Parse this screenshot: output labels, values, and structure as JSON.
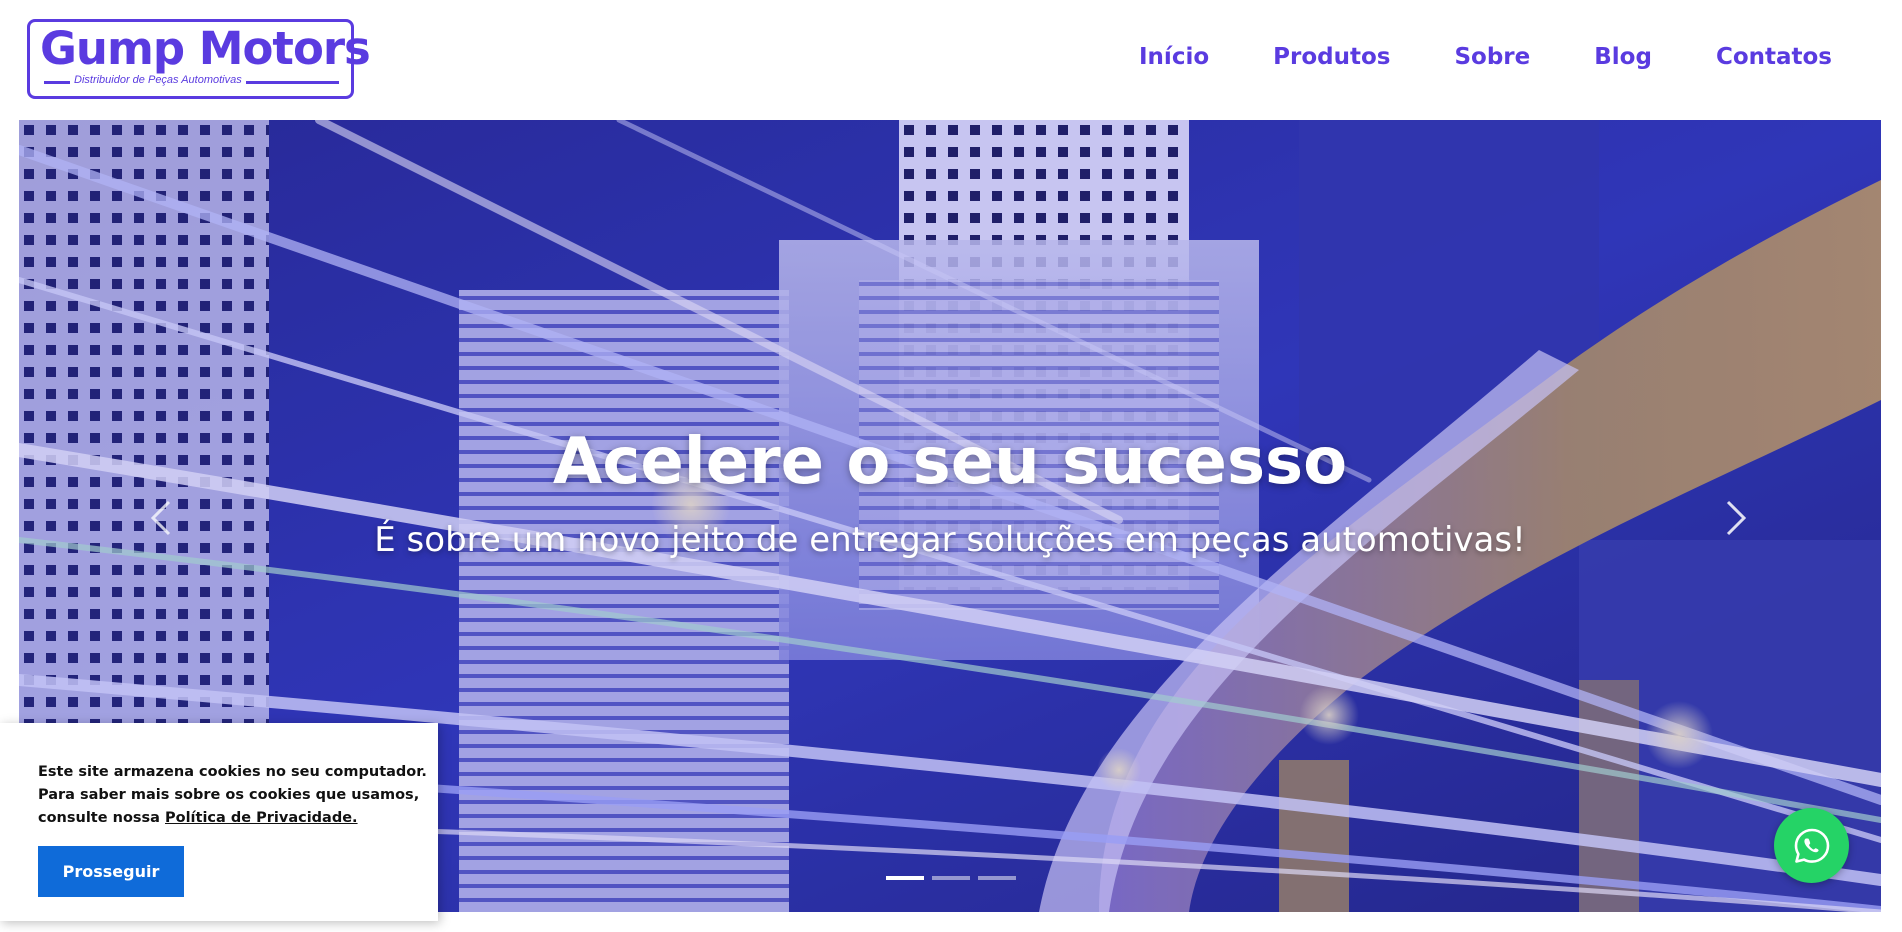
{
  "header": {
    "logo": {
      "title": "Gump Motors",
      "subtitle": "Distribuidor de Peças Automotivas"
    },
    "nav": [
      "Início",
      "Produtos",
      "Sobre",
      "Blog",
      "Contatos"
    ]
  },
  "hero": {
    "title": "Acelere o seu sucesso",
    "subtitle": "É sobre um novo jeito de entregar soluções em peças automotivas!",
    "slides_count": 3,
    "active_slide": 1
  },
  "cookie_banner": {
    "line1": "Este site armazena cookies no seu computador.",
    "line2": "Para saber mais sobre os cookies que usamos,",
    "line3_prefix": "consulte nossa ",
    "link": "Política de Privacidade.",
    "button": "Prosseguir"
  },
  "colors": {
    "brand": "#5a3be0",
    "button": "#0f6bd9",
    "whatsapp": "#25d366"
  },
  "icons": {
    "prev": "chevron-left-icon",
    "next": "chevron-right-icon",
    "whatsapp": "whatsapp-icon"
  }
}
